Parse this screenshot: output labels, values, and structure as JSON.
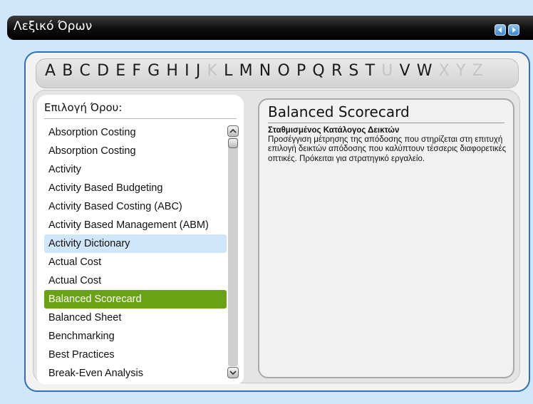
{
  "window": {
    "title": "Λεξικό Όρων"
  },
  "alphabet": [
    {
      "letter": "A",
      "enabled": true
    },
    {
      "letter": "B",
      "enabled": true
    },
    {
      "letter": "C",
      "enabled": true
    },
    {
      "letter": "D",
      "enabled": true
    },
    {
      "letter": "E",
      "enabled": true
    },
    {
      "letter": "F",
      "enabled": true
    },
    {
      "letter": "G",
      "enabled": true
    },
    {
      "letter": "H",
      "enabled": true
    },
    {
      "letter": "I",
      "enabled": true
    },
    {
      "letter": "J",
      "enabled": true
    },
    {
      "letter": "K",
      "enabled": false
    },
    {
      "letter": "L",
      "enabled": true
    },
    {
      "letter": "M",
      "enabled": true
    },
    {
      "letter": "N",
      "enabled": true
    },
    {
      "letter": "O",
      "enabled": true
    },
    {
      "letter": "P",
      "enabled": true
    },
    {
      "letter": "Q",
      "enabled": true
    },
    {
      "letter": "R",
      "enabled": true
    },
    {
      "letter": "S",
      "enabled": true
    },
    {
      "letter": "T",
      "enabled": true
    },
    {
      "letter": "U",
      "enabled": false
    },
    {
      "letter": "V",
      "enabled": true
    },
    {
      "letter": "W",
      "enabled": true
    },
    {
      "letter": "X",
      "enabled": false
    },
    {
      "letter": "Y",
      "enabled": false
    },
    {
      "letter": "Z",
      "enabled": false
    }
  ],
  "term_list": {
    "header": "Επιλογή Όρου:",
    "items": [
      {
        "label": "Absorption Costing",
        "state": "normal"
      },
      {
        "label": "Absorption Costing",
        "state": "normal"
      },
      {
        "label": "Activity",
        "state": "normal"
      },
      {
        "label": "Activity Based Budgeting",
        "state": "normal"
      },
      {
        "label": "Activity Based Costing (ABC)",
        "state": "normal"
      },
      {
        "label": "Activity Based Management (ABM)",
        "state": "normal"
      },
      {
        "label": "Activity Dictionary",
        "state": "hover"
      },
      {
        "label": "Actual Cost",
        "state": "normal"
      },
      {
        "label": "Actual Cost",
        "state": "normal"
      },
      {
        "label": "Balanced Scorecard",
        "state": "selected"
      },
      {
        "label": "Balanced Sheet",
        "state": "normal"
      },
      {
        "label": "Benchmarking",
        "state": "normal"
      },
      {
        "label": "Best Practices",
        "state": "normal"
      },
      {
        "label": "Break-Even Analysis",
        "state": "normal"
      }
    ]
  },
  "definition": {
    "term": "Balanced Scorecard",
    "greek_term": "Σταθμισμένος Κατάλογος Δεικτών",
    "text": "Προσέγγιση μέτρησης της απόδοσης που στηρίζεται στη επιτυχή επιλογή δεικτών απόδοσης που καλύπτουν τέσσερις διαφορετικές οπτικές. Πρόκειται για στρατηγικό εργαλείο."
  },
  "colors": {
    "accent": "#2f6fb4",
    "selected": "#6aa216",
    "hover": "#cfe6fb",
    "background": "#cfe6fb"
  }
}
